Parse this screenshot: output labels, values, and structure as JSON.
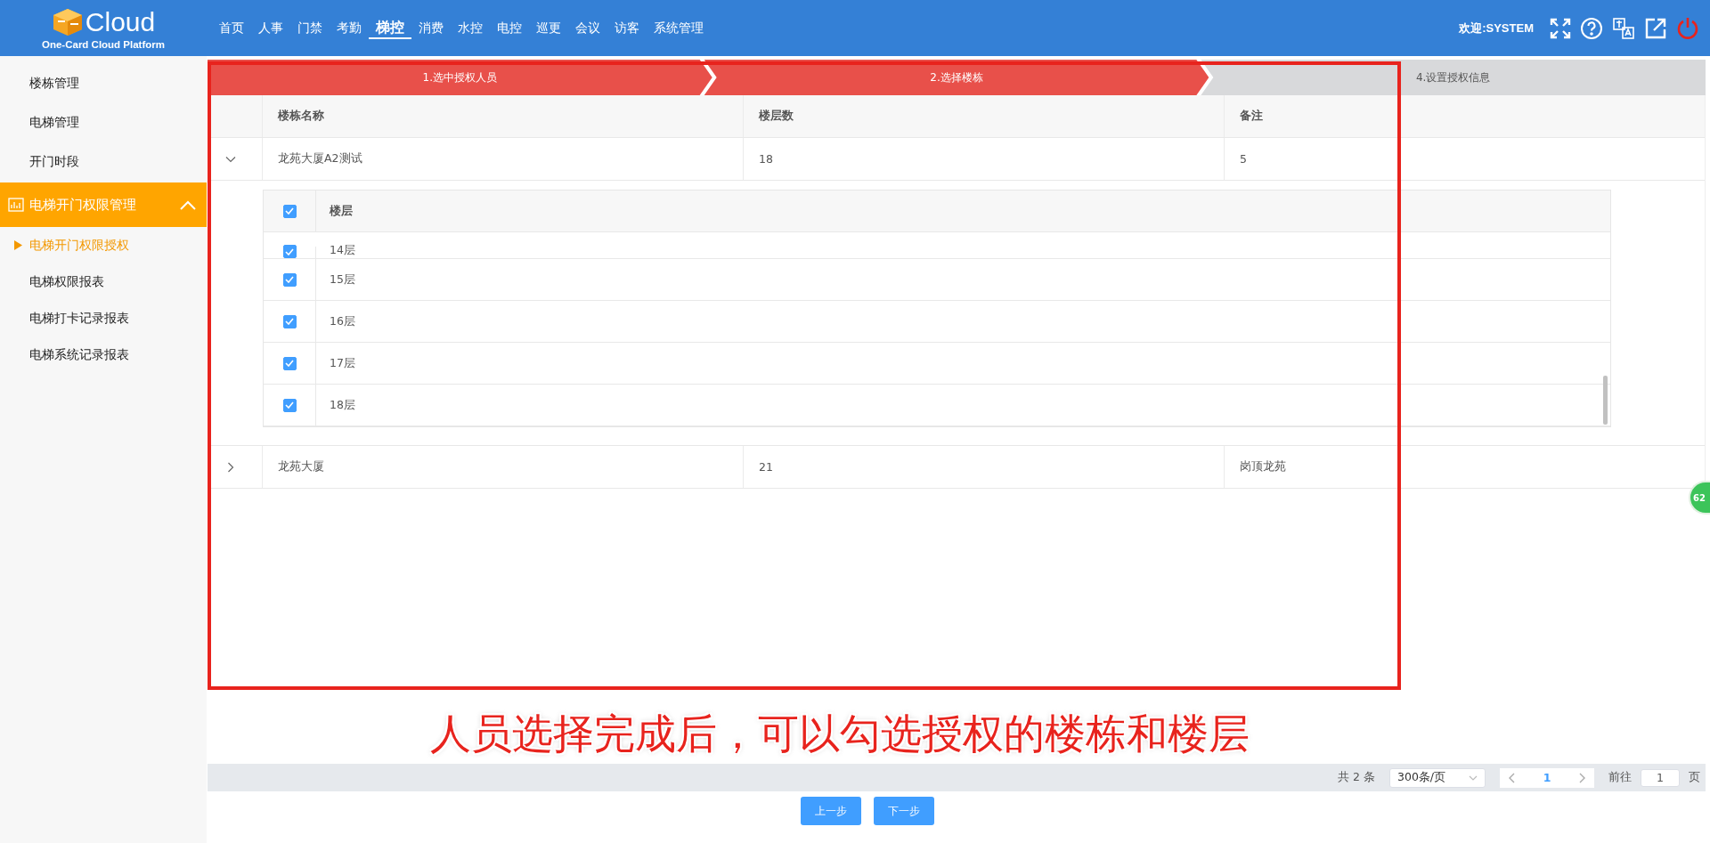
{
  "header": {
    "logo_text": "Cloud",
    "logo_subtitle": "One-Card Cloud Platform",
    "welcome": "欢迎:SYSTEM"
  },
  "nav": [
    {
      "label": "首页",
      "selected": false
    },
    {
      "label": "人事",
      "selected": false
    },
    {
      "label": "门禁",
      "selected": false
    },
    {
      "label": "考勤",
      "selected": false
    },
    {
      "label": "梯控",
      "selected": true
    },
    {
      "label": "消费",
      "selected": false
    },
    {
      "label": "水控",
      "selected": false
    },
    {
      "label": "电控",
      "selected": false
    },
    {
      "label": "巡更",
      "selected": false
    },
    {
      "label": "会议",
      "selected": false
    },
    {
      "label": "访客",
      "selected": false
    },
    {
      "label": "系统管理",
      "selected": false
    }
  ],
  "sidebar": {
    "items": [
      {
        "label": "楼栋管理"
      },
      {
        "label": "电梯管理"
      },
      {
        "label": "开门时段"
      }
    ],
    "group": {
      "label": "电梯开门权限管理",
      "expanded": true,
      "children": [
        {
          "label": "电梯开门权限授权",
          "selected": true
        },
        {
          "label": "电梯权限报表",
          "selected": false
        },
        {
          "label": "电梯打卡记录报表",
          "selected": false
        },
        {
          "label": "电梯系统记录报表",
          "selected": false
        }
      ]
    }
  },
  "steps": [
    {
      "label": "1.选中授权人员",
      "done": true
    },
    {
      "label": "2.选择楼栋",
      "done": true
    },
    {
      "label": "4.设置授权信息",
      "done": false
    }
  ],
  "table": {
    "columns": [
      "楼栋名称",
      "楼层数",
      "备注"
    ],
    "rows": [
      {
        "expanded": true,
        "cells": [
          "龙苑大厦A2测试",
          "18",
          "5"
        ],
        "floors": {
          "column": "楼层",
          "all_checked": true,
          "rows": [
            {
              "label": "14层",
              "checked": true
            },
            {
              "label": "15层",
              "checked": true
            },
            {
              "label": "16层",
              "checked": true
            },
            {
              "label": "17层",
              "checked": true
            },
            {
              "label": "18层",
              "checked": true
            }
          ]
        }
      },
      {
        "expanded": false,
        "cells": [
          "龙苑大厦",
          "21",
          "岗顶龙苑"
        ]
      }
    ]
  },
  "annotation": "人员选择完成后，可以勾选授权的楼栋和楼层",
  "float_badge": "62",
  "pagination": {
    "total": "共 2 条",
    "page_size": "300条/页",
    "current_page": "1",
    "goto_label": "前往",
    "goto_value": "1",
    "page_unit": "页"
  },
  "buttons": [
    "上一步",
    "下一步"
  ]
}
